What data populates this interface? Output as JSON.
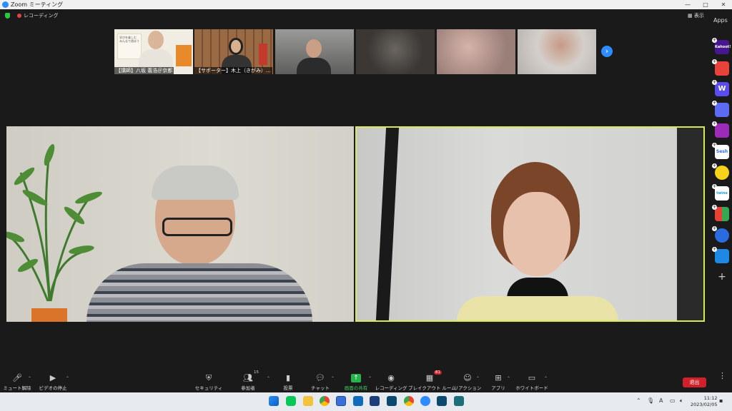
{
  "window": {
    "title": "Zoom ミーティング",
    "minimize": "—",
    "maximize": "□",
    "close": "✕"
  },
  "topbar": {
    "recording_label": "レコーディング",
    "view_label": "▦ 表示"
  },
  "apps_label": "Apps",
  "participants_strip": [
    {
      "name": "【講師】八坂 義浩＠京都"
    },
    {
      "name": "【サポーター】木上（きがみ）..."
    },
    {
      "name": ""
    },
    {
      "name": ""
    },
    {
      "name": ""
    },
    {
      "name": ""
    }
  ],
  "poster_text": [
    "学びを楽しむ",
    "みんなで遊ぼう"
  ],
  "sidebar_apps": [
    {
      "label": "Kahoot!",
      "color": "#46178f"
    },
    {
      "label": "",
      "color": "#e8433a"
    },
    {
      "label": "W",
      "color": "#5b4cf0"
    },
    {
      "label": "",
      "color": "#5c6bf2"
    },
    {
      "label": "",
      "color": "#9b2bb8"
    },
    {
      "label": "Sesh",
      "color": "#ffffff"
    },
    {
      "label": "",
      "color": "#f7d21a"
    },
    {
      "label": "twine",
      "color": "#ffffff"
    },
    {
      "label": "",
      "color": "#ffffff"
    },
    {
      "label": "",
      "color": "#2b6be0"
    },
    {
      "label": "",
      "color": "#1e88e5"
    }
  ],
  "sidebar_add": "+",
  "toolbar": {
    "unmute": "ミュート解除",
    "stop_video": "ビデオの停止",
    "security": "セキュリティ",
    "participants": "参加者",
    "participants_count": "15",
    "polls": "投票",
    "chat": "チャット",
    "share_screen": "画面の共有",
    "record": "レコーディング",
    "breakout": "ブレイクアウト ルーム",
    "breakout_badge": "81",
    "reactions": "リアクション",
    "apps": "アプリ",
    "whiteboard": "ホワイトボード",
    "leave": "退出"
  },
  "taskbar": {
    "time": "11:12",
    "date": "2023/02/05",
    "ime": "A"
  }
}
